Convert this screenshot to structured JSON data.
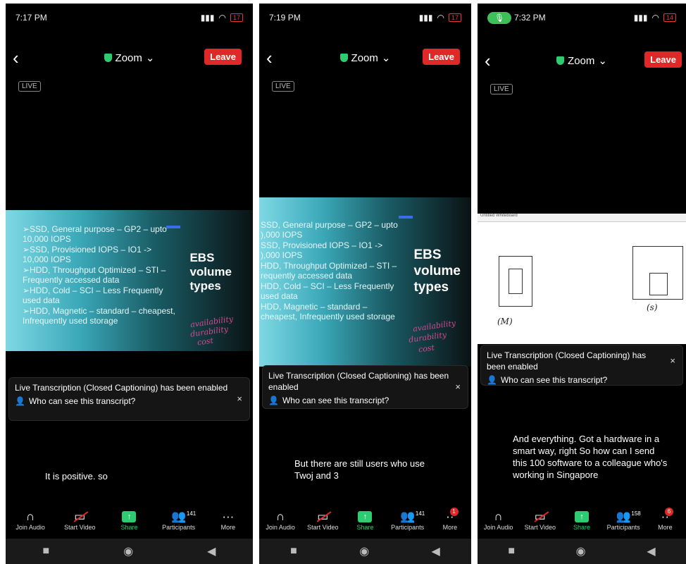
{
  "panels": [
    {
      "time": "7:17 PM",
      "battery": "17",
      "title": "Zoom",
      "leave": "Leave",
      "live": "LIVE",
      "slide": {
        "bullets": [
          "➢SSD, General purpose – GP2 – upto 10,000 IOPS",
          "➢SSD, Provisioned IOPS – IO1 -> 10,000 IOPS",
          "➢HDD, Throughput Optimized – STI – Frequently accessed data",
          "➢HDD, Cold – SCI – Less Frequently used data",
          "➢HDD, Magnetic – standard – cheapest, Infrequently used storage"
        ],
        "heading": [
          "EBS",
          "volume",
          "types"
        ],
        "notes": [
          "availability",
          "durability",
          "cost"
        ]
      },
      "caption": {
        "text": "Live Transcription (Closed Captioning) has been enabled",
        "who": "Who can see this transcript?",
        "close": "×"
      },
      "subtitle": "It is positive. so",
      "toolbar": {
        "join_audio": "Join Audio",
        "start_video": "Start Video",
        "share": "Share",
        "participants": "Participants",
        "participants_count": "141",
        "more": "More",
        "more_badge": ""
      }
    },
    {
      "time": "7:19 PM",
      "battery": "17",
      "title": "Zoom",
      "leave": "Leave",
      "live": "LIVE",
      "slide": {
        "bullets": [
          "SSD, General purpose – GP2 – upto ),000 IOPS",
          "SSD, Provisioned IOPS – IO1 -> ),000 IOPS",
          "HDD, Throughput Optimized – STI – requently accessed data",
          "HDD, Cold – SCI – Less Frequently used data",
          "HDD, Magnetic – standard – cheapest, Infrequently used storage"
        ],
        "heading": [
          "EBS",
          "volume",
          "types"
        ],
        "notes": [
          "availability",
          "durability",
          "cost"
        ]
      },
      "caption": {
        "text": "Live Transcription (Closed Captioning) has been enabled",
        "who": "Who can see this transcript?",
        "close": "×"
      },
      "subtitle": "But there are still users who use Twoj and 3",
      "toolbar": {
        "join_audio": "Join Audio",
        "start_video": "Start Video",
        "share": "Share",
        "participants": "Participants",
        "participants_count": "141",
        "more": "More",
        "more_badge": "1"
      }
    },
    {
      "time": "7:32 PM",
      "battery": "14",
      "title": "Zoom",
      "leave": "Leave",
      "live": "LIVE",
      "whiteboard": {
        "toolbar": "Untitled Whiteboard",
        "labels": [
          "(M)",
          "(s)"
        ]
      },
      "caption": {
        "text": "Live Transcription (Closed Captioning) has been enabled",
        "who": "Who can see this transcript?",
        "close": "×"
      },
      "subtitle": "And everything. Got a hardware in a smart way, right So how can I send this 100 software to a colleague who's working in Singapore",
      "toolbar": {
        "join_audio": "Join Audio",
        "start_video": "Start Video",
        "share": "Share",
        "participants": "Participants",
        "participants_count": "158",
        "more": "More",
        "more_badge": "6"
      }
    }
  ]
}
